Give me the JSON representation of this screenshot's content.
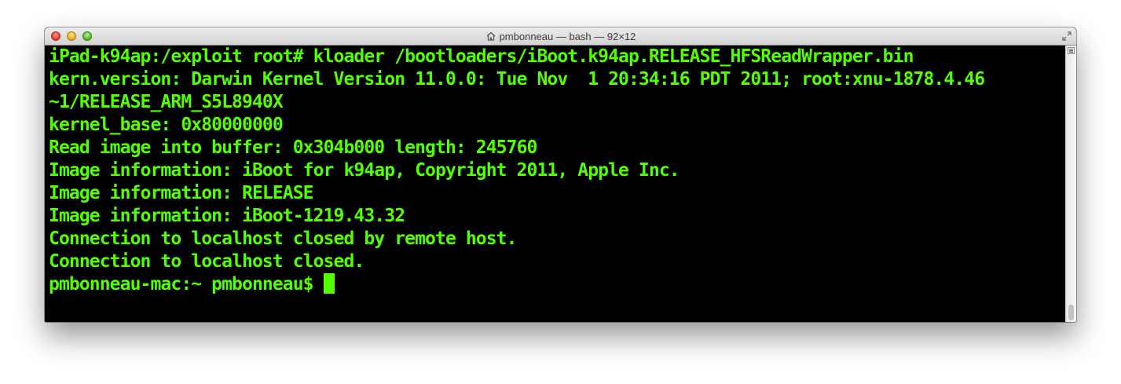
{
  "window": {
    "title": "pmbonneau — bash — 92×12"
  },
  "terminal": {
    "lines": [
      "iPad-k94ap:/exploit root# kloader /bootloaders/iBoot.k94ap.RELEASE_HFSReadWrapper.bin",
      "kern.version: Darwin Kernel Version 11.0.0: Tue Nov  1 20:34:16 PDT 2011; root:xnu-1878.4.46",
      "~1/RELEASE_ARM_S5L8940X",
      "kernel_base: 0x80000000",
      "Read image into buffer: 0x304b000 length: 245760",
      "Image information: iBoot for k94ap, Copyright 2011, Apple Inc.",
      "Image information: RELEASE",
      "Image information: iBoot-1219.43.32",
      "Connection to localhost closed by remote host.",
      "Connection to localhost closed.",
      "pmbonneau-mac:~ pmbonneau$ "
    ],
    "text_color": "#52ff00",
    "background": "#000000"
  },
  "icons": {
    "title_icon": "home-icon",
    "fullscreen": "fullscreen-icon",
    "scroll_menu": "menu-icon"
  }
}
